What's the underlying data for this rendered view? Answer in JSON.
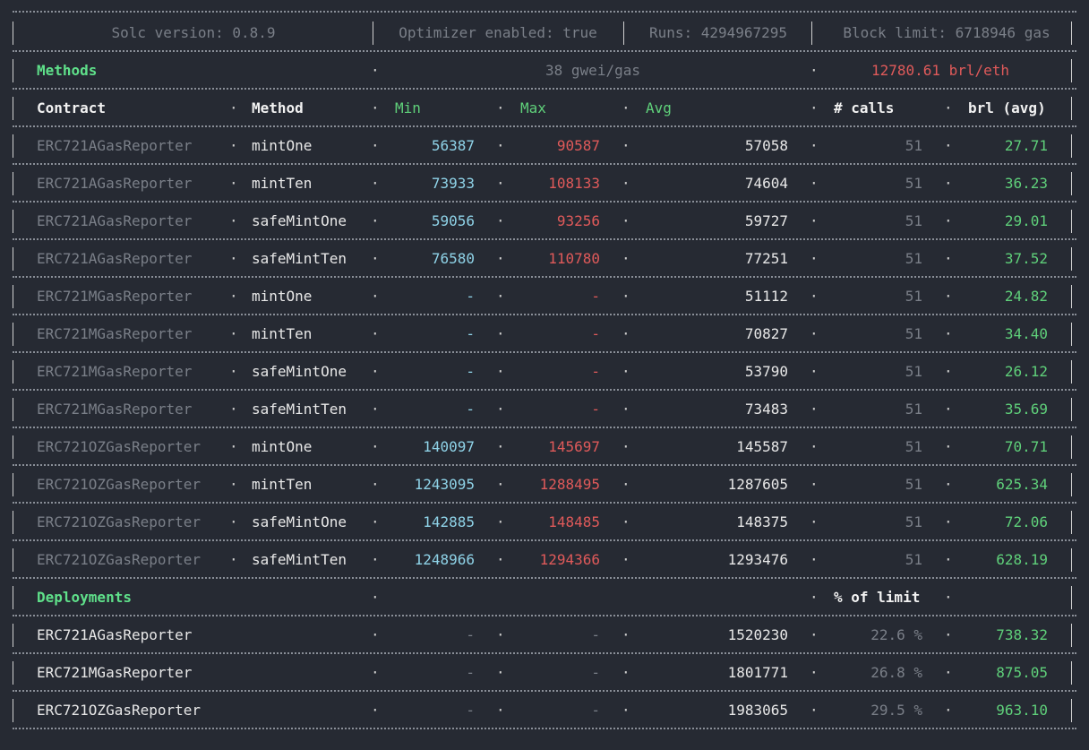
{
  "config": {
    "solc": "Solc version: 0.8.9",
    "optimizer": "Optimizer enabled: true",
    "runs": "Runs: 4294967295",
    "block_limit": "Block limit: 6718946 gas"
  },
  "methods_header": {
    "label": "Methods",
    "gas_price": "38 gwei/gas",
    "rate": "12780.61 brl/eth"
  },
  "columns": {
    "contract": "Contract",
    "method": "Method",
    "min": "Min",
    "max": "Max",
    "avg": "Avg",
    "calls": "# calls",
    "cost": "brl (avg)"
  },
  "methods": [
    {
      "contract": "ERC721AGasReporter",
      "method": "mintOne",
      "min": "56387",
      "max": "90587",
      "avg": "57058",
      "calls": "51",
      "cost": "27.71"
    },
    {
      "contract": "ERC721AGasReporter",
      "method": "mintTen",
      "min": "73933",
      "max": "108133",
      "avg": "74604",
      "calls": "51",
      "cost": "36.23"
    },
    {
      "contract": "ERC721AGasReporter",
      "method": "safeMintOne",
      "min": "59056",
      "max": "93256",
      "avg": "59727",
      "calls": "51",
      "cost": "29.01"
    },
    {
      "contract": "ERC721AGasReporter",
      "method": "safeMintTen",
      "min": "76580",
      "max": "110780",
      "avg": "77251",
      "calls": "51",
      "cost": "37.52"
    },
    {
      "contract": "ERC721MGasReporter",
      "method": "mintOne",
      "min": "-",
      "max": "-",
      "avg": "51112",
      "calls": "51",
      "cost": "24.82"
    },
    {
      "contract": "ERC721MGasReporter",
      "method": "mintTen",
      "min": "-",
      "max": "-",
      "avg": "70827",
      "calls": "51",
      "cost": "34.40"
    },
    {
      "contract": "ERC721MGasReporter",
      "method": "safeMintOne",
      "min": "-",
      "max": "-",
      "avg": "53790",
      "calls": "51",
      "cost": "26.12"
    },
    {
      "contract": "ERC721MGasReporter",
      "method": "safeMintTen",
      "min": "-",
      "max": "-",
      "avg": "73483",
      "calls": "51",
      "cost": "35.69"
    },
    {
      "contract": "ERC721OZGasReporter",
      "method": "mintOne",
      "min": "140097",
      "max": "145697",
      "avg": "145587",
      "calls": "51",
      "cost": "70.71"
    },
    {
      "contract": "ERC721OZGasReporter",
      "method": "mintTen",
      "min": "1243095",
      "max": "1288495",
      "avg": "1287605",
      "calls": "51",
      "cost": "625.34"
    },
    {
      "contract": "ERC721OZGasReporter",
      "method": "safeMintOne",
      "min": "142885",
      "max": "148485",
      "avg": "148375",
      "calls": "51",
      "cost": "72.06"
    },
    {
      "contract": "ERC721OZGasReporter",
      "method": "safeMintTen",
      "min": "1248966",
      "max": "1294366",
      "avg": "1293476",
      "calls": "51",
      "cost": "628.19"
    }
  ],
  "deployments_header": {
    "label": "Deployments",
    "limit_label": "% of limit"
  },
  "deployments": [
    {
      "contract": "ERC721AGasReporter",
      "min": "-",
      "max": "-",
      "avg": "1520230",
      "limit": "22.6 %",
      "cost": "738.32"
    },
    {
      "contract": "ERC721MGasReporter",
      "min": "-",
      "max": "-",
      "avg": "1801771",
      "limit": "26.8 %",
      "cost": "875.05"
    },
    {
      "contract": "ERC721OZGasReporter",
      "min": "-",
      "max": "-",
      "avg": "1983065",
      "limit": "29.5 %",
      "cost": "963.10"
    }
  ],
  "colors": {
    "background": "#262a33",
    "min": "#8fd3e8",
    "max": "#e05a5a",
    "cost": "#5fd07a",
    "section": "#5fe08a"
  }
}
